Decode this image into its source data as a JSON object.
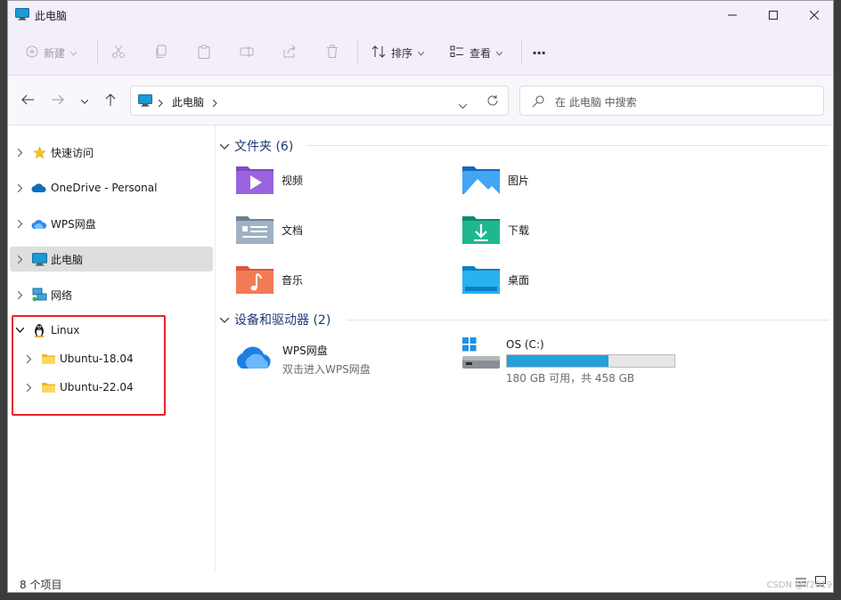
{
  "window": {
    "title": "此电脑",
    "controls": [
      "minimize",
      "maximize",
      "close"
    ]
  },
  "toolbar": {
    "new_label": "新建",
    "sort_label": "排序",
    "view_label": "查看",
    "more_label": "···"
  },
  "address": {
    "location": "此电脑",
    "search_placeholder": "在 此电脑 中搜索"
  },
  "sidebar": {
    "items": [
      {
        "label": "快速访问",
        "icon": "star-icon"
      },
      {
        "label": "OneDrive - Personal",
        "icon": "onedrive-cloud-icon"
      },
      {
        "label": "WPS网盘",
        "icon": "wps-cloud-icon"
      },
      {
        "label": "此电脑",
        "icon": "computer-icon",
        "selected": true
      },
      {
        "label": "网络",
        "icon": "network-icon"
      },
      {
        "label": "Linux",
        "icon": "linux-penguin-icon",
        "expanded": true
      },
      {
        "label": "Ubuntu-18.04",
        "icon": "folder-icon"
      },
      {
        "label": "Ubuntu-22.04",
        "icon": "folder-icon"
      }
    ]
  },
  "folders": {
    "header": "文件夹 (6)",
    "items": [
      {
        "label": "视频",
        "icon": "videos-folder-icon"
      },
      {
        "label": "图片",
        "icon": "pictures-folder-icon"
      },
      {
        "label": "文档",
        "icon": "documents-folder-icon"
      },
      {
        "label": "下载",
        "icon": "downloads-folder-icon"
      },
      {
        "label": "音乐",
        "icon": "music-folder-icon"
      },
      {
        "label": "桌面",
        "icon": "desktop-folder-icon"
      }
    ]
  },
  "devices": {
    "header": "设备和驱动器 (2)",
    "wps": {
      "label": "WPS网盘",
      "subtitle": "双击进入WPS网盘"
    },
    "os": {
      "label": "OS (C:)",
      "free_text": "180 GB 可用，共 458 GB",
      "used_fraction": 0.607
    }
  },
  "status": {
    "item_count": "8 个项目"
  },
  "watermark": "CSDN @if2019",
  "colors": {
    "accent": "#0078d4",
    "drive_bar": "#26a0da",
    "highlight_box": "#e8212a"
  }
}
